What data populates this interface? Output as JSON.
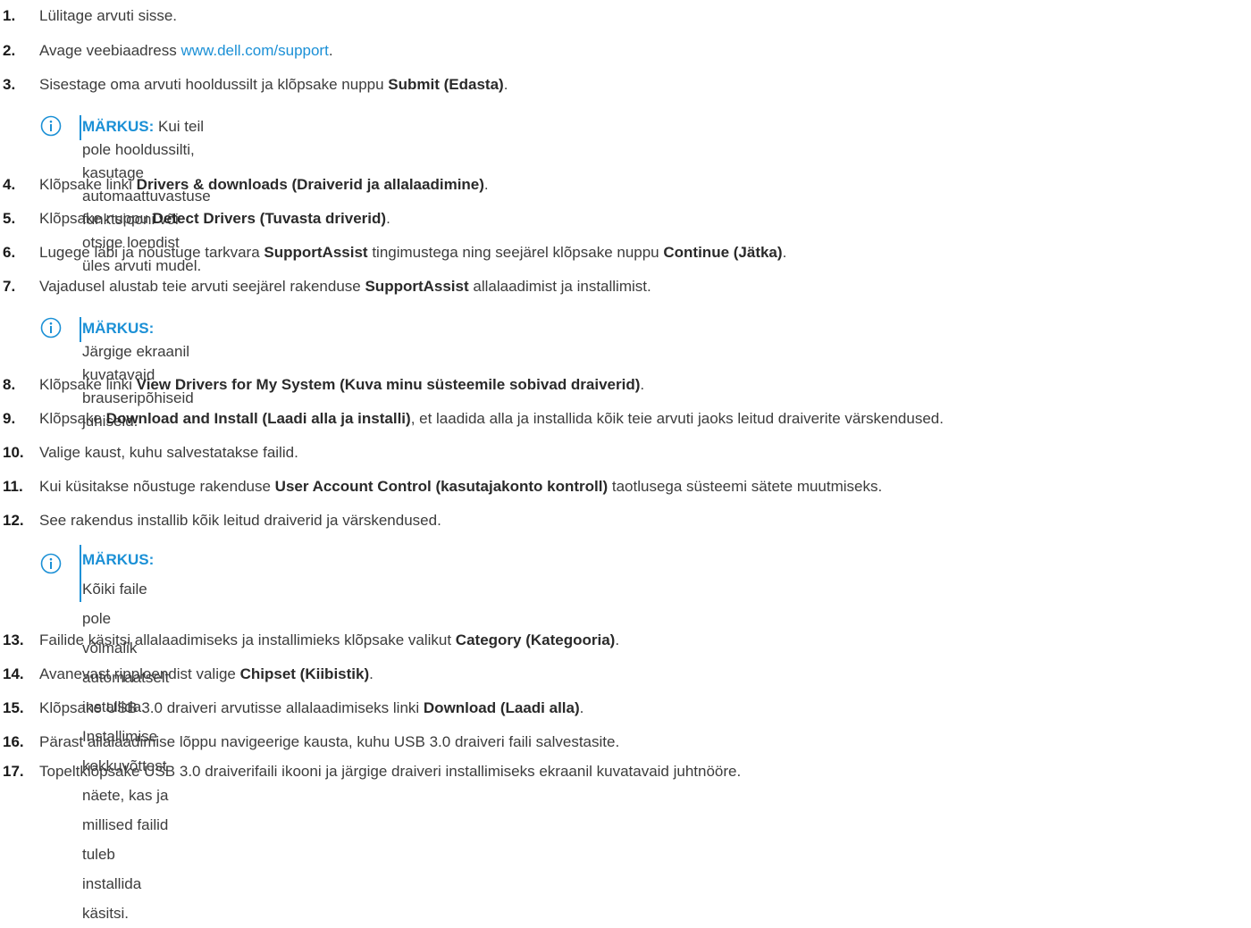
{
  "steps": [
    {
      "n": "1.",
      "parts": [
        {
          "t": "Lülitage arvuti sisse."
        }
      ]
    },
    {
      "n": "2.",
      "parts": [
        {
          "t": "Avage veebiaadress "
        },
        {
          "t": "www.dell.com/support",
          "link": true
        },
        {
          "t": "."
        }
      ]
    },
    {
      "n": "3.",
      "parts": [
        {
          "t": "Sisestage oma arvuti hooldussilt ja klõpsake nuppu "
        },
        {
          "t": "Submit (Edasta)",
          "b": true
        },
        {
          "t": "."
        }
      ]
    },
    {
      "n": "4.",
      "parts": [
        {
          "t": "Klõpsake linki "
        },
        {
          "t": "Drivers & downloads (Draiverid ja allalaadimine)",
          "b": true
        },
        {
          "t": "."
        }
      ]
    },
    {
      "n": "5.",
      "parts": [
        {
          "t": "Klõpsake nuppu "
        },
        {
          "t": "Detect Drivers (Tuvasta driverid)",
          "b": true
        },
        {
          "t": "."
        }
      ]
    },
    {
      "n": "6.",
      "parts": [
        {
          "t": "Lugege läbi ja nõustuge tarkvara "
        },
        {
          "t": "SupportAssist",
          "b": true
        },
        {
          "t": " tingimustega ning seejärel klõpsake nuppu "
        },
        {
          "t": "Continue (Jätka)",
          "b": true
        },
        {
          "t": "."
        }
      ]
    },
    {
      "n": "7.",
      "parts": [
        {
          "t": "Vajadusel alustab teie arvuti seejärel rakenduse "
        },
        {
          "t": "SupportAssist",
          "b": true
        },
        {
          "t": " allalaadimist ja installimist."
        }
      ]
    },
    {
      "n": "8.",
      "parts": [
        {
          "t": "Klõpsake linki "
        },
        {
          "t": "View Drivers for My System (Kuva minu süsteemile sobivad draiverid)",
          "b": true
        },
        {
          "t": "."
        }
      ]
    },
    {
      "n": "9.",
      "parts": [
        {
          "t": "Klõpsake "
        },
        {
          "t": "Download and Install (Laadi alla ja installi)",
          "b": true
        },
        {
          "t": ", et laadida alla ja installida kõik teie arvuti jaoks leitud draiverite värskendused."
        }
      ]
    },
    {
      "n": "10.",
      "parts": [
        {
          "t": "Valige kaust, kuhu salvestatakse failid."
        }
      ]
    },
    {
      "n": "11.",
      "parts": [
        {
          "t": "Kui küsitakse nõustuge rakenduse "
        },
        {
          "t": "User Account Control (kasutajakonto kontroll)",
          "b": true
        },
        {
          "t": " taotlusega süsteemi sätete muutmiseks."
        }
      ]
    },
    {
      "n": "12.",
      "parts": [
        {
          "t": "See rakendus installib kõik leitud draiverid ja värskendused."
        }
      ]
    },
    {
      "n": "13.",
      "parts": [
        {
          "t": "Failide käsitsi allalaadimiseks ja installimieks klõpsake valikut "
        },
        {
          "t": "Category (Kategooria)",
          "b": true
        },
        {
          "t": "."
        }
      ]
    },
    {
      "n": "14.",
      "parts": [
        {
          "t": "Avanevast ripploendist valige "
        },
        {
          "t": "Chipset (Kiibistik)",
          "b": true
        },
        {
          "t": "."
        }
      ]
    },
    {
      "n": "15.",
      "parts": [
        {
          "t": "Klõpsake USB 3.0 draiveri arvutisse allalaadimiseks linki "
        },
        {
          "t": "Download (Laadi alla)",
          "b": true
        },
        {
          "t": "."
        }
      ]
    },
    {
      "n": "16.",
      "parts": [
        {
          "t": "Pärast allalaadimise lõppu navigeerige kausta, kuhu USB 3.0 draiveri faili salvestasite."
        }
      ]
    },
    {
      "n": "17.",
      "parts": [
        {
          "t": "Topeltklõpsake USB 3.0 draiverifaili ikooni ja järgige draiveri installimiseks ekraanil kuvatavaid juhtnööre."
        }
      ]
    }
  ],
  "notes": [
    {
      "label": "MÄRKUS:",
      "lines": [
        "Kui teil pole hooldussilti, kasutage automaattuvastuse funktsiooni või otsige loendist üles arvuti mudel."
      ]
    },
    {
      "label": "MÄRKUS:",
      "lines": [
        "Järgige ekraanil kuvatavaid brauseripõhiseid juhiseid."
      ]
    },
    {
      "label": "MÄRKUS:",
      "lines": [
        "Kõiki faile pole võimalik automaatselt installida. Installimise kokkuvõttest näete, kas ja millised failid tuleb installida",
        "käsitsi."
      ]
    }
  ],
  "icons": {
    "note": "info-icon"
  },
  "colors": {
    "accent": "#1b90d6",
    "text": "#3c3c3c"
  }
}
